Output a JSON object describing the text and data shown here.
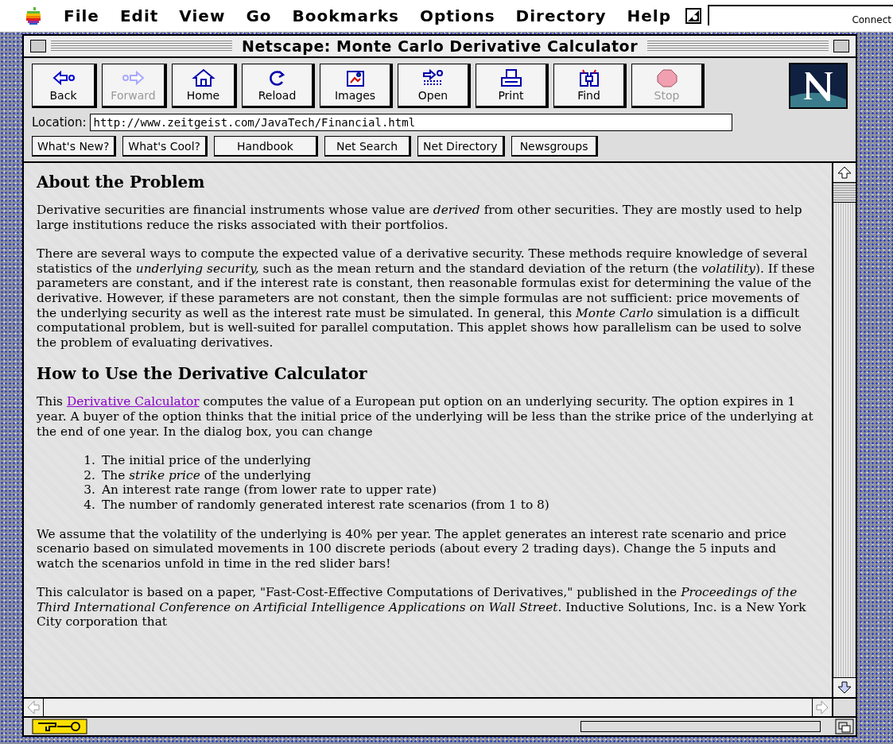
{
  "menubar": {
    "items": [
      "File",
      "Edit",
      "View",
      "Go",
      "Bookmarks",
      "Options",
      "Directory",
      "Help"
    ],
    "status_label": "Connect"
  },
  "window": {
    "title": "Netscape: Monte Carlo Derivative Calculator"
  },
  "toolbar": {
    "buttons": [
      {
        "kind": "back",
        "label": "Back",
        "disabled": false
      },
      {
        "kind": "forward",
        "label": "Forward",
        "disabled": true
      },
      {
        "kind": "home",
        "label": "Home",
        "disabled": false
      },
      {
        "kind": "reload",
        "label": "Reload",
        "disabled": false
      },
      {
        "kind": "images",
        "label": "Images",
        "disabled": false
      },
      {
        "kind": "open",
        "label": "Open",
        "disabled": false
      },
      {
        "kind": "print",
        "label": "Print",
        "disabled": false
      },
      {
        "kind": "find",
        "label": "Find",
        "disabled": false
      },
      {
        "kind": "stop",
        "label": "Stop",
        "disabled": true
      }
    ]
  },
  "location": {
    "label": "Location:",
    "value": "http://www.zeitgeist.com/JavaTech/Financial.html"
  },
  "directory_buttons": [
    "What's New?",
    "What's Cool?",
    "Handbook",
    "Net Search",
    "Net Directory",
    "Newsgroups"
  ],
  "content": [
    {
      "kind": "heading",
      "text": "About the Problem"
    },
    {
      "kind": "paragraph",
      "text": "Derivative securities are financial instruments whose value are *derived* from other securities. They are mostly used to help large institutions reduce the risks associated with their portfolios."
    },
    {
      "kind": "paragraph",
      "text": "There are several ways to compute the expected value of a derivative security. These methods require knowledge of several statistics of the *underlying security,* such as the mean return and the standard deviation of the return (the *volatility*). If these parameters are constant, and if the interest rate is constant, then reasonable formulas exist for determining the value of the derivative. However, if these parameters are not constant, then the simple formulas are not sufficient: price movements of the underlying security as well as the interest rate must be simulated. In general, this *Monte Carlo* simulation is a difficult computational problem, but is well-suited for parallel computation. This applet shows how parallelism can be used to solve the problem of evaluating derivatives."
    },
    {
      "kind": "heading",
      "text": "How to Use the Derivative Calculator"
    },
    {
      "kind": "link_paragraph",
      "before": "This",
      "link": "Derivative Calculator",
      "after": "computes the value of a European put option on an underlying security. The option expires in 1 year. A buyer of the option thinks that the initial price of the underlying will be less than the strike price of the underlying at the end of one year. In the dialog box, you can change"
    },
    {
      "kind": "list",
      "items": [
        {
          "number": "1.",
          "text": "The initial price of the underlying"
        },
        {
          "number": "2.",
          "text": "The *strike price* of the underlying"
        },
        {
          "number": "3.",
          "text": "An interest rate range (from lower rate to upper rate)"
        },
        {
          "number": "4.",
          "text": "The number of randomly generated interest rate scenarios (from 1 to 8)"
        }
      ]
    },
    {
      "kind": "paragraph",
      "text": "We assume that the volatility of the underlying is 40% per year. The applet generates an interest rate scenario and price scenario based on simulated movements in 100 discrete periods (about every 2 trading days). Change the 5 inputs and watch the scenarios unfold in time in the red slider bars!"
    },
    {
      "kind": "paragraph",
      "text": "This calculator is based on a paper, \"Fast-Cost-Effective Computations of Derivatives,\" published in the *Proceedings of the Third International Conference on Artificial Intelligence Applications on Wall Street*. Inductive Solutions, Inc. is a New York City corporation that"
    }
  ]
}
